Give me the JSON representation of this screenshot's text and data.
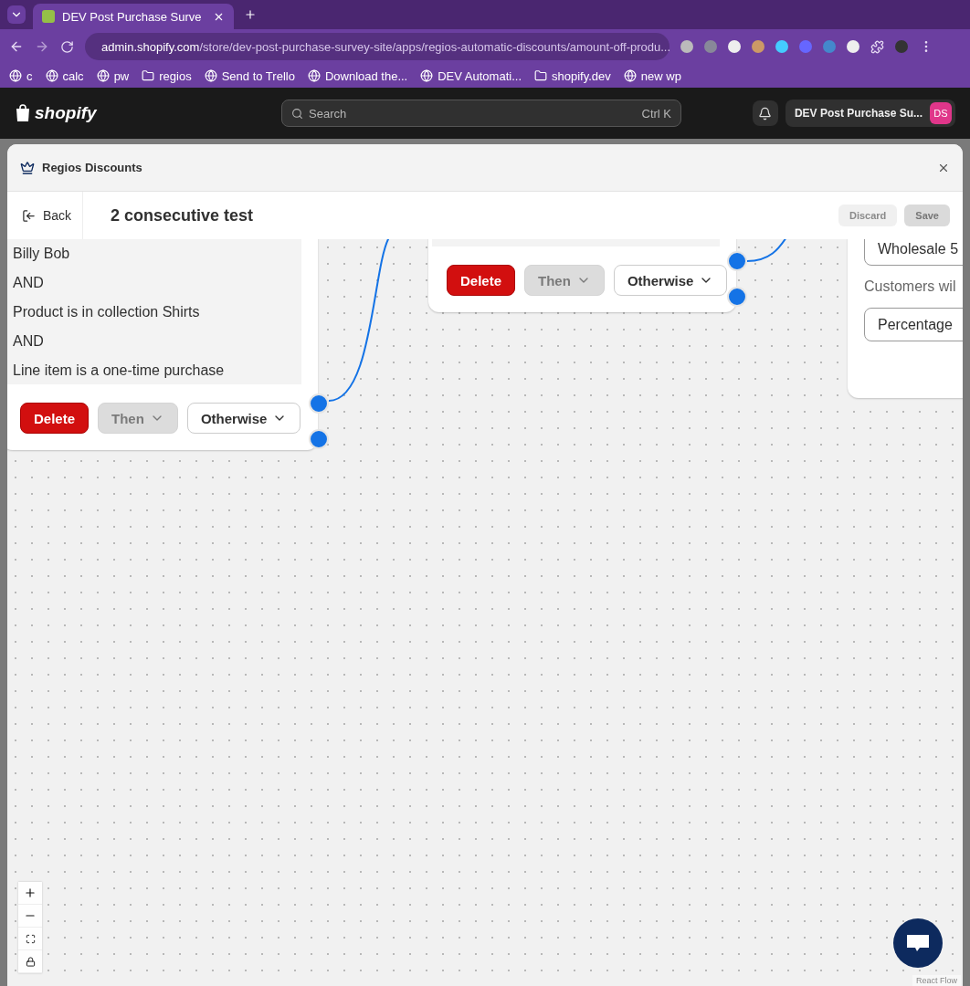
{
  "browser": {
    "tabs": [
      {
        "title": "DEV Post Purchase Surve",
        "selected": true
      }
    ],
    "url_host": "admin.shopify.com",
    "url_path": "/store/dev-post-purchase-survey-site/apps/regios-automatic-discounts/amount-off-produ...",
    "bookmarks": [
      {
        "label": "c",
        "kind": "site"
      },
      {
        "label": "calc",
        "kind": "site"
      },
      {
        "label": "pw",
        "kind": "site"
      },
      {
        "label": "regios",
        "kind": "folder"
      },
      {
        "label": "Send to Trello",
        "kind": "site"
      },
      {
        "label": "Download the...",
        "kind": "site"
      },
      {
        "label": "DEV Automati...",
        "kind": "site"
      },
      {
        "label": "shopify.dev",
        "kind": "folder"
      },
      {
        "label": "new wp",
        "kind": "site"
      }
    ]
  },
  "admin_bar": {
    "brand": "shopify",
    "search": {
      "placeholder": "Search",
      "shortcut": "Ctrl K"
    },
    "store_name": "DEV Post Purchase Su...",
    "avatar_initials": "DS"
  },
  "modal": {
    "title": "Regios Discounts",
    "back_label": "Back",
    "page_title": "2 consecutive test",
    "actions": [
      {
        "label": "Discard",
        "disabled": true
      },
      {
        "label": "Save",
        "disabled": true
      }
    ]
  },
  "canvas": {
    "nodes": [
      {
        "kind": "condition",
        "lines": [
          "Billy Bob",
          "AND",
          "Product is in collection Shirts",
          "AND",
          "Line item is a one-time purchase"
        ],
        "buttons": [
          {
            "label": "Delete",
            "kind": "danger",
            "disabled": false
          },
          {
            "label": "Then",
            "kind": "menu",
            "disabled": true
          },
          {
            "label": "Otherwise",
            "kind": "menu",
            "disabled": false
          }
        ]
      },
      {
        "kind": "condition",
        "buttons": [
          {
            "label": "Delete",
            "kind": "danger",
            "disabled": false
          },
          {
            "label": "Then",
            "kind": "menu",
            "disabled": true
          },
          {
            "label": "Otherwise",
            "kind": "menu",
            "disabled": false
          }
        ]
      },
      {
        "kind": "action",
        "fields": [
          {
            "kind": "input",
            "value": "Wholesale 5"
          },
          {
            "kind": "help",
            "text": "Customers wil"
          },
          {
            "kind": "select",
            "value": "Percentage"
          }
        ]
      }
    ],
    "attribution": "React Flow"
  }
}
